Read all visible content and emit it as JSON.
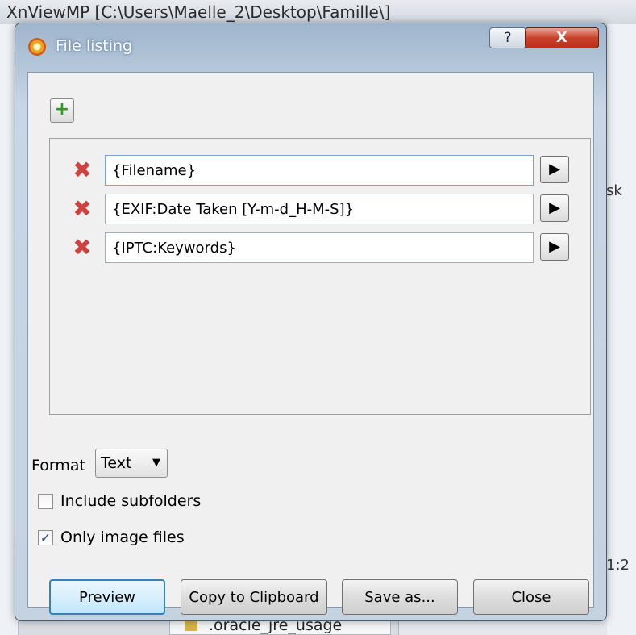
{
  "background": {
    "title": "XnViewMP [C:\\Users\\Maelle_2\\Desktop\\Famille\\]",
    "right_edge": [
      "sk",
      "1:2"
    ],
    "folder_item": ".oracle_jre_usage"
  },
  "dialog": {
    "title": "File listing",
    "help_label": "?",
    "close_label": "X",
    "add_label": "+",
    "fields": [
      {
        "value": "{Filename}"
      },
      {
        "value": "{EXIF:Date Taken [Y-m-d_H-M-S]}"
      },
      {
        "value": "{IPTC:Keywords}"
      }
    ],
    "delete_label": "✖",
    "arrow_label": "▶",
    "format_label": "Format",
    "format_value": "Text",
    "include_subfolders": {
      "label": "Include subfolders",
      "checked": false
    },
    "only_images": {
      "label": "Only image files",
      "checked": true
    },
    "buttons": {
      "preview": "Preview",
      "copy": "Copy to Clipboard",
      "save": "Save as...",
      "close": "Close"
    }
  },
  "icons": {
    "app": "xnview-flower-icon",
    "add": "plus-icon",
    "delete": "red-x-icon",
    "arrow": "play-arrow-icon"
  },
  "colors": {
    "accent": "#3c7fb1",
    "delete": "#d0413d",
    "add": "#2f9c1e",
    "close": "#c9412a"
  }
}
